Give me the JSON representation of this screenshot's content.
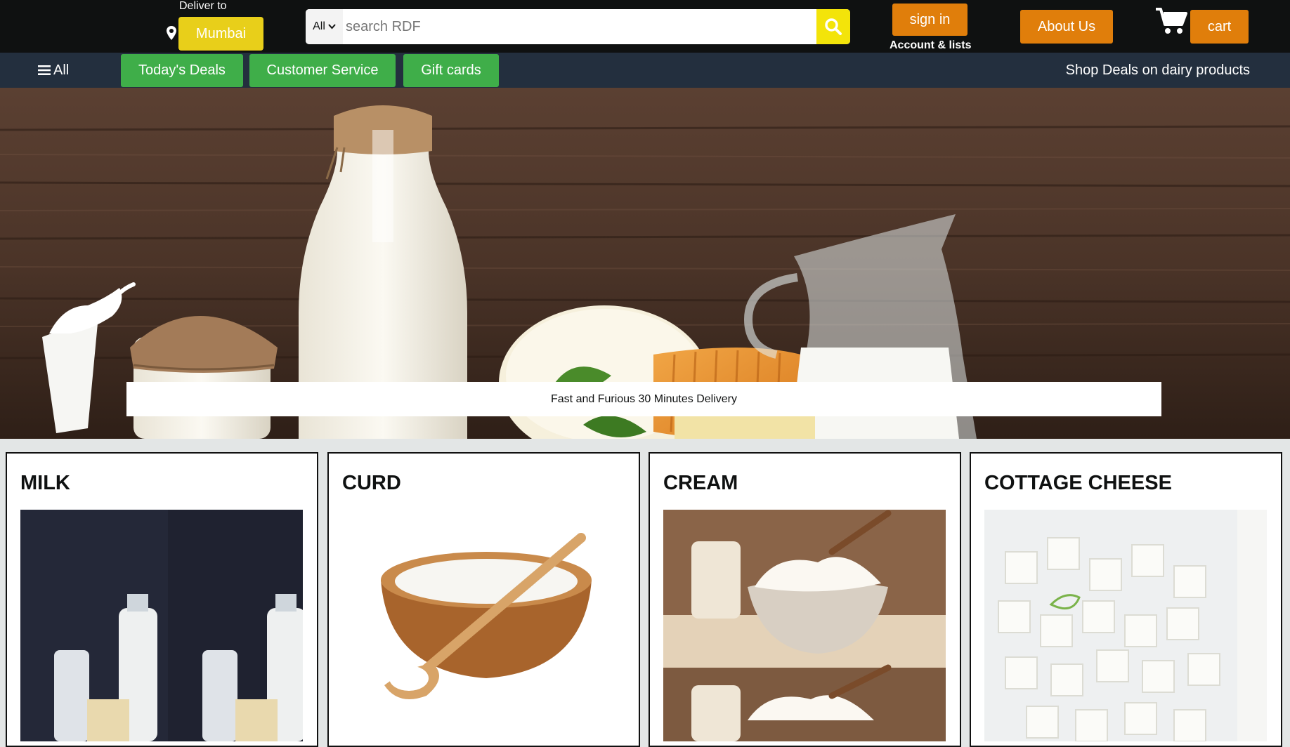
{
  "header": {
    "deliver_label": "Deliver to",
    "city": "Mumbai",
    "search": {
      "category": "All",
      "placeholder": "search RDF"
    },
    "signin_label": "sign in",
    "account_label": "Account & lists",
    "about_label": "About Us",
    "cart_label": "cart",
    "icons": [
      "location-pin-icon",
      "search-icon",
      "shopping-cart-icon"
    ]
  },
  "subnav": {
    "all_label": "All",
    "links": [
      "Today's Deals",
      "Customer Service",
      "Gift cards"
    ],
    "deals_text": "Shop Deals on dairy products"
  },
  "hero": {
    "banner_text": "Fast and Furious 30 Minutes Delivery"
  },
  "products": [
    {
      "title": "MILK"
    },
    {
      "title": "CURD"
    },
    {
      "title": "CREAM"
    },
    {
      "title": "COTTAGE CHEESE"
    }
  ],
  "colors": {
    "topbar": "#0f1111",
    "subbar": "#232f3e",
    "orange": "#e07e0b",
    "yellow": "#e8cf1a",
    "green": "#3fae49",
    "search_button": "#f3e40a"
  }
}
